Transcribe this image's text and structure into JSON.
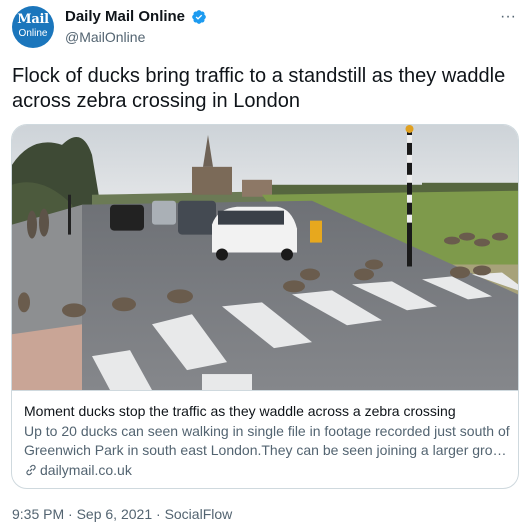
{
  "colors": {
    "brand": "#1b76bc",
    "verified": "#1d9bf0",
    "text_primary": "#0f1419",
    "text_secondary": "#536471",
    "border": "#cfd9de"
  },
  "author": {
    "avatar_line1": "Mail",
    "avatar_line2": "Online",
    "display_name": "Daily Mail Online",
    "handle": "@MailOnline",
    "verified_icon": "verified-badge-icon",
    "more_icon": "more-horizontal-icon",
    "more_glyph": "···"
  },
  "tweet": {
    "text": "Flock of ducks bring traffic to a standstill as they waddle across zebra crossing in London"
  },
  "card": {
    "media_icon": "street-photo-ducks-crossing",
    "title": "Moment ducks stop the traffic as they waddle across a zebra crossing",
    "description": "Up to 20 ducks can seen walking in single file in footage recorded just south of Greenwich Park in south east London.They can be seen joining a larger group o...",
    "domain": "dailymail.co.uk",
    "domain_icon": "link-icon"
  },
  "meta": {
    "time": "9:35 PM",
    "separator1": " · ",
    "date": "Sep 6, 2021",
    "separator2": " · ",
    "source": "SocialFlow"
  }
}
